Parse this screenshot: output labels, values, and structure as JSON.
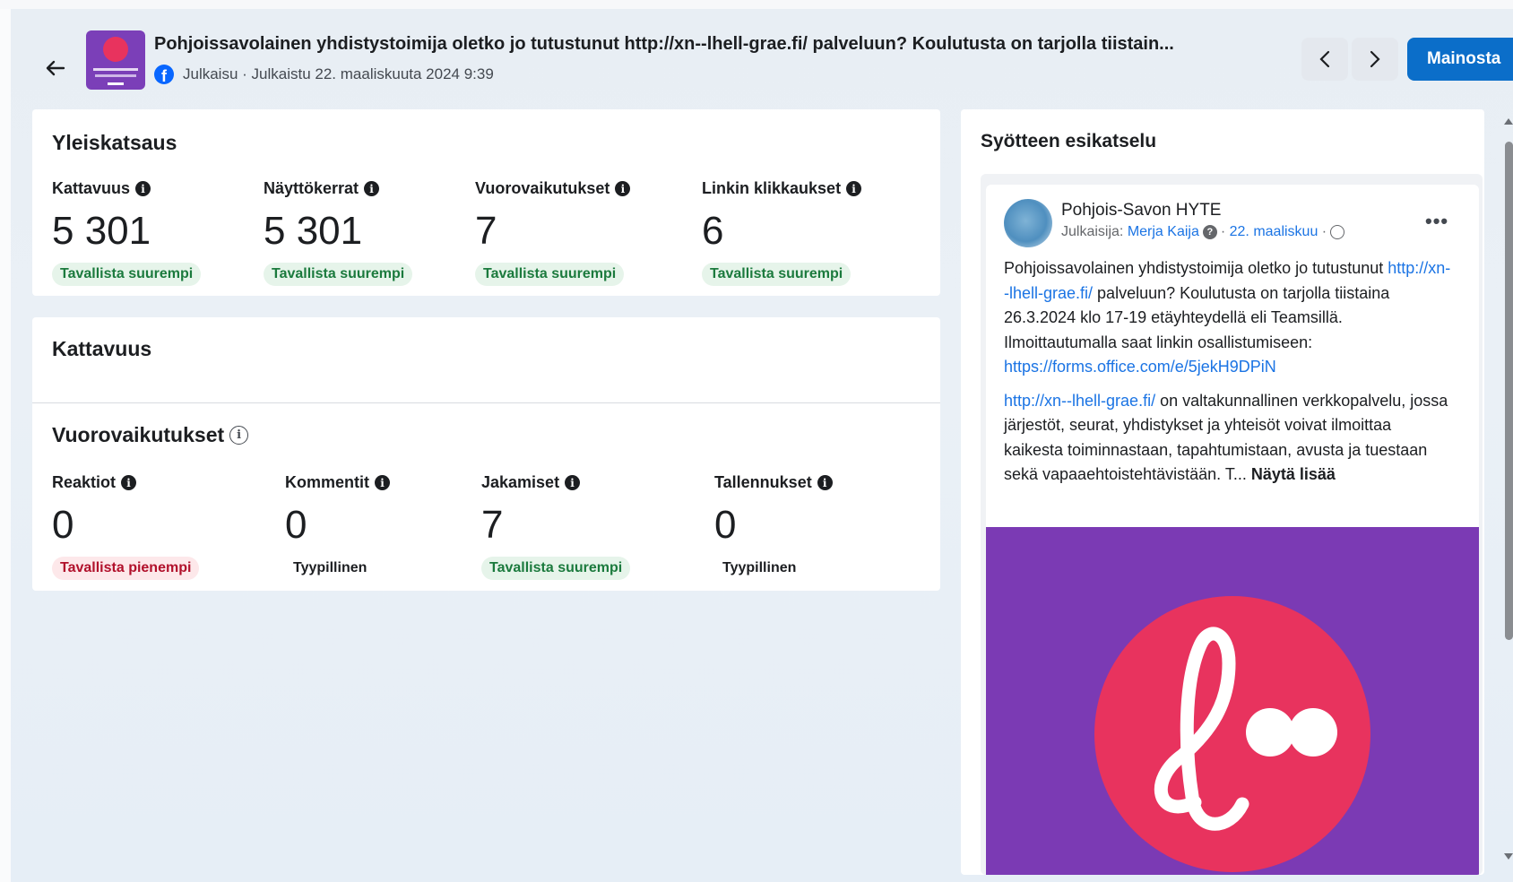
{
  "header": {
    "title": "Pohjoissavolainen yhdistystoimija oletko jo tutustunut http://xn--lhell-grae.fi/ palveluun? Koulutusta on tarjolla tiistain...",
    "meta": "Julkaisu · Julkaistu 22. maaliskuuta 2024 9:39",
    "promote_label": "Mainosta",
    "icons": {
      "back": "arrow-left-icon",
      "platform": "facebook-icon",
      "prev": "chevron-left-icon",
      "next": "chevron-right-icon"
    }
  },
  "overview": {
    "title": "Yleiskatsaus",
    "metrics": [
      {
        "label": "Kattavuus",
        "value": "5 301",
        "badge": "Tavallista suurempi",
        "status": "good"
      },
      {
        "label": "Näyttökerrat",
        "value": "5 301",
        "badge": "Tavallista suurempi",
        "status": "good"
      },
      {
        "label": "Vuorovaikutukset",
        "value": "7",
        "badge": "Tavallista suurempi",
        "status": "good"
      },
      {
        "label": "Linkin klikkaukset",
        "value": "6",
        "badge": "Tavallista suurempi",
        "status": "good"
      }
    ]
  },
  "reach": {
    "title": "Kattavuus"
  },
  "interactions": {
    "title": "Vuorovaikutukset",
    "metrics": [
      {
        "label": "Reaktiot",
        "value": "0",
        "badge": "Tavallista pienempi",
        "status": "bad"
      },
      {
        "label": "Kommentit",
        "value": "0",
        "badge": "Tyypillinen",
        "status": "neutral"
      },
      {
        "label": "Jakamiset",
        "value": "7",
        "badge": "Tavallista suurempi",
        "status": "good"
      },
      {
        "label": "Tallennukset",
        "value": "0",
        "badge": "Tyypillinen",
        "status": "neutral"
      }
    ]
  },
  "preview": {
    "title": "Syötteen esikatselu",
    "page_name": "Pohjois-Savon HYTE",
    "publisher_prefix": "Julkaisija:",
    "publisher_name": "Merja Kaija",
    "date": "22. maaliskuu",
    "body_1a": "Pohjoissavolainen yhdistystoimija oletko jo tutustunut ",
    "body_1_link": "http://xn--lhell-grae.fi/",
    "body_1b": " palveluun? Koulutusta on tarjolla tiistaina 26.3.2024 klo 17-19 etäyhteydellä eli Teamsillä. Ilmoittautumalla saat linkin osallistumiseen: ",
    "body_1_link2": "https://forms.office.com/e/5jekH9DPiN",
    "body_2_link": "http://xn--lhell-grae.fi/",
    "body_2": " on valtakunnallinen verkkopalvelu, jossa järjestöt, seurat, yhdistykset ja yhteisöt voivat ilmoittaa kaikesta toiminnastaan, tapahtumistaan, avusta ja tuestaan sekä vapaaehtoistehtävistään.  T... ",
    "see_more": "Näytä lisää"
  },
  "colors": {
    "accent": "#0b6ec9",
    "good": "#1b7a3d",
    "bad": "#b1102b",
    "image_bg": "#7b3ab4",
    "logo": "#e8335e"
  }
}
